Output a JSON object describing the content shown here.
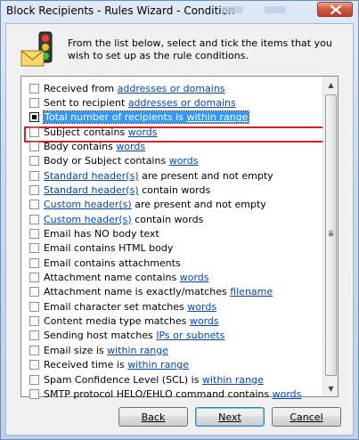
{
  "window": {
    "title": "Block Recipients - Rules Wizard - Condition",
    "close_icon": "close-icon"
  },
  "header": {
    "icon": "traffic-light-envelope-icon",
    "instruction": "From the list below, select and tick the items that you wish to set up as the rule conditions."
  },
  "conditions": [
    {
      "pre": "Received from ",
      "link": "addresses or domains",
      "post": "",
      "checked": false
    },
    {
      "pre": "Sent to recipient ",
      "link": "addresses or domains",
      "post": "",
      "checked": false
    },
    {
      "pre": "Total number of recipients is ",
      "link": "within range",
      "post": "",
      "checked": true,
      "selected": true
    },
    {
      "pre": "Subject contains ",
      "link": "words",
      "post": "",
      "checked": false
    },
    {
      "pre": "Body contains ",
      "link": "words",
      "post": "",
      "checked": false
    },
    {
      "pre": "Body or Subject contains ",
      "link": "words",
      "post": "",
      "checked": false
    },
    {
      "pre": "",
      "link": "Standard header(s)",
      "post": " are present and not empty",
      "checked": false
    },
    {
      "pre": "",
      "link": "Standard header(s)",
      "post": " contain words",
      "checked": false
    },
    {
      "pre": "",
      "link": "Custom header(s)",
      "post": " are present and not empty",
      "checked": false
    },
    {
      "pre": "",
      "link": "Custom header(s)",
      "post": " contain words",
      "checked": false
    },
    {
      "pre": "Email has NO body text",
      "link": "",
      "post": "",
      "checked": false
    },
    {
      "pre": "Email contains HTML body",
      "link": "",
      "post": "",
      "checked": false
    },
    {
      "pre": "Email contains attachments",
      "link": "",
      "post": "",
      "checked": false
    },
    {
      "pre": "Attachment name contains ",
      "link": "words",
      "post": "",
      "checked": false
    },
    {
      "pre": "Attachment name is exactly/matches ",
      "link": "filename",
      "post": "",
      "checked": false
    },
    {
      "pre": "Email character set matches ",
      "link": "words",
      "post": "",
      "checked": false
    },
    {
      "pre": "Content media type matches ",
      "link": "words",
      "post": "",
      "checked": false
    },
    {
      "pre": "Sending host matches ",
      "link": "IPs or subnets",
      "post": "",
      "checked": false
    },
    {
      "pre": "Email size is ",
      "link": "within range",
      "post": "",
      "checked": false
    },
    {
      "pre": "Received time is ",
      "link": "within range",
      "post": "",
      "checked": false
    },
    {
      "pre": "Spam Confidence Level (SCL) is ",
      "link": "within range",
      "post": "",
      "checked": false
    },
    {
      "pre": "SMTP protocol HELO/EHLO command contains ",
      "link": "words",
      "post": "",
      "checked": false
    }
  ],
  "buttons": {
    "back_label": "Back",
    "next_label": "Next",
    "cancel_label": "Cancel"
  },
  "colors": {
    "link": "#0044cc",
    "selection": "#3399ff",
    "highlight_box": "#d4242a"
  }
}
